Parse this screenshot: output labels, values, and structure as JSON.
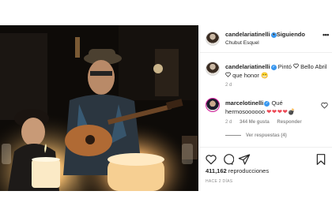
{
  "post": {
    "username": "candelariatinelli",
    "verified_glyph": "✓",
    "follow_label": "• Siguiendo",
    "location": "Chubut Esquel",
    "more_options": "•••"
  },
  "caption": {
    "username": "candelariatinelli",
    "text_part1": "Pintó",
    "text_part2": "Bello Abril",
    "text_part3": "que honor",
    "emoji": "😁",
    "time": "2 d"
  },
  "comment": {
    "username": "marcelotinelli",
    "text": "Qué hermosoooooo",
    "hearts": "❤❤❤❤",
    "extra_emoji": "💣",
    "time": "2 d",
    "likes": "344 Me gusta",
    "reply_label": "Responder",
    "view_replies": "Ver respuestas (4)"
  },
  "stats": {
    "views_count": "411,162",
    "views_label": "reproducciones",
    "post_age": "HACE 2 DÍAS"
  },
  "colors": {
    "accent": "#3897f0",
    "heart_red": "#ed4956",
    "secondary_text": "#8e8e8e"
  },
  "icons": [
    "heart-icon",
    "comment-icon",
    "share-icon",
    "bookmark-icon",
    "mute-icon",
    "verified-icon"
  ]
}
